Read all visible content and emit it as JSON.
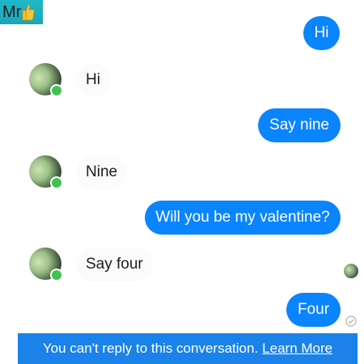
{
  "watermark": {
    "text": "Mr",
    "icon": "thumbs-up-icon"
  },
  "messages": [
    {
      "direction": "outgoing",
      "text": "Hi"
    },
    {
      "direction": "incoming",
      "text": "Hi"
    },
    {
      "direction": "outgoing",
      "text": "Say nine"
    },
    {
      "direction": "incoming",
      "text": "Nine"
    },
    {
      "direction": "outgoing",
      "text": "Will you be my valentine?"
    },
    {
      "direction": "incoming",
      "text": "Say four"
    },
    {
      "direction": "outgoing",
      "text": "Four"
    }
  ],
  "footer": {
    "notice": "You can't reply to this conversation.",
    "link": "Learn More"
  },
  "colors": {
    "outgoing_bubble": "#0a84ff",
    "footer_background": "#1a82e8",
    "online_indicator": "#3fc24f"
  }
}
